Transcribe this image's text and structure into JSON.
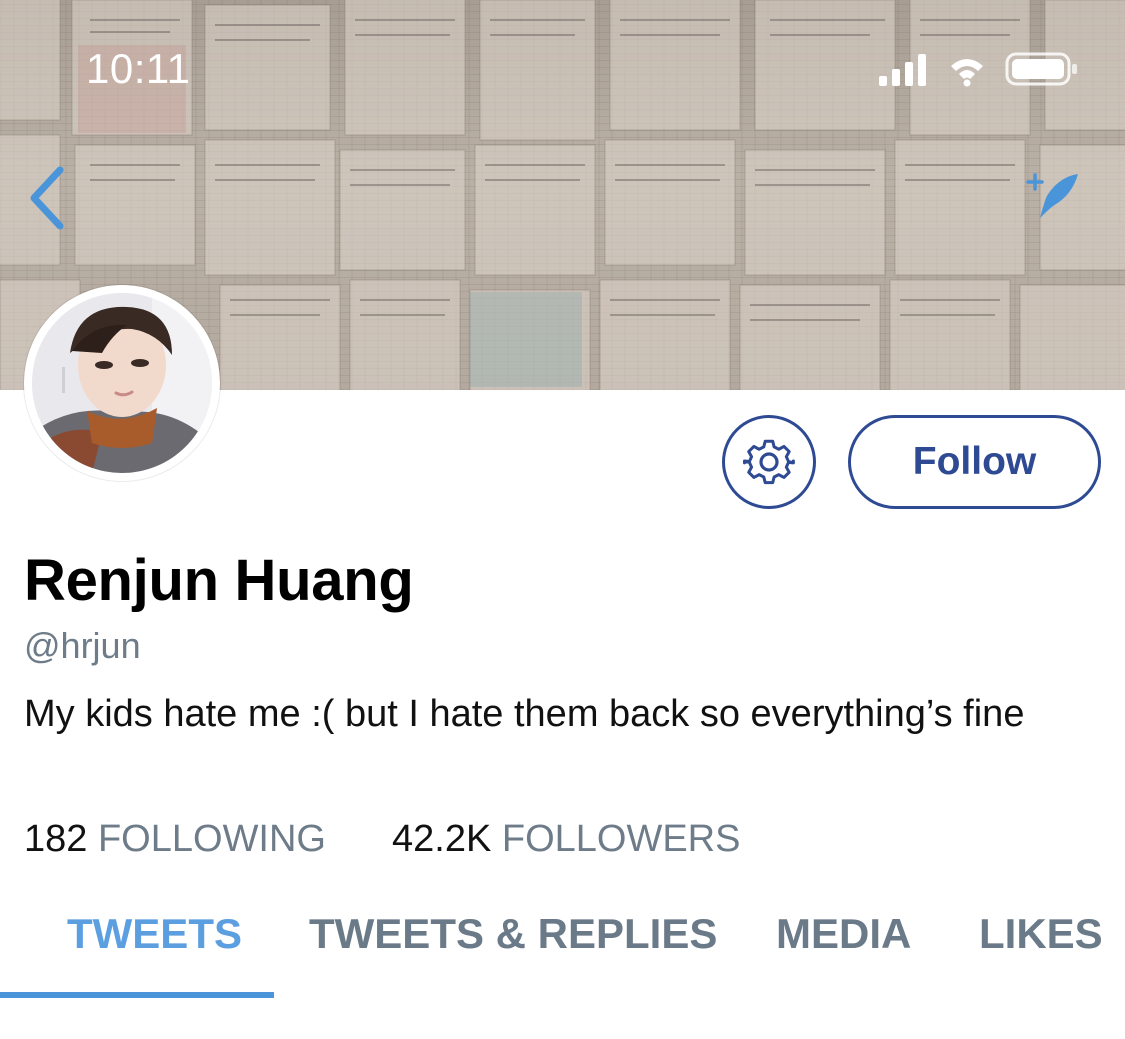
{
  "status_bar": {
    "time": "10:11"
  },
  "header": {
    "back_icon": "chevron-left-icon",
    "compose_icon": "feather-sparkle-icon",
    "accent_color": "#4a94da"
  },
  "actions": {
    "settings_icon": "gear-icon",
    "follow_label": "Follow",
    "button_color": "#2e4a93"
  },
  "profile": {
    "name": "Renjun Huang",
    "handle": "@hrjun",
    "bio": "My kids hate me :( but I hate them back so everything’s fine",
    "following_count": "182",
    "following_label": "FOLLOWING",
    "followers_count": "42.2K",
    "followers_label": "FOLLOWERS"
  },
  "tabs": [
    {
      "label": "TWEETS",
      "active": true
    },
    {
      "label": "TWEETS & REPLIES",
      "active": false
    },
    {
      "label": "MEDIA",
      "active": false
    },
    {
      "label": "LIKES",
      "active": false
    }
  ]
}
